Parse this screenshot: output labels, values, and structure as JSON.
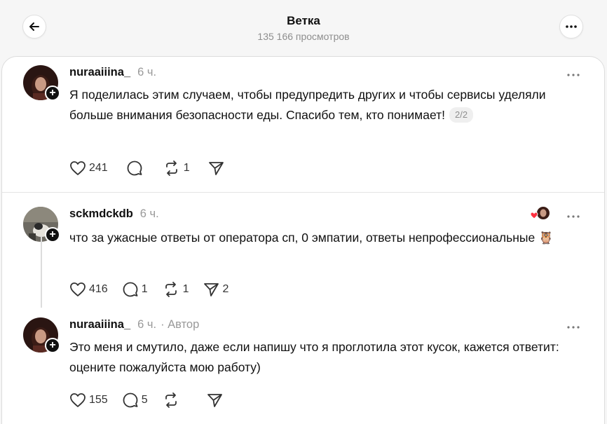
{
  "header": {
    "title": "Ветка",
    "views": "135 166 просмотров"
  },
  "posts": [
    {
      "username": "nuraaiiina_",
      "time": "6 ч.",
      "text": "Я поделилась этим случаем, чтобы предупредить других и чтобы сервисы уделяли больше внимания безопасности еды. Спасибо тем, кто понимает!",
      "pager": "2/2",
      "likes": "241",
      "replies": "",
      "reposts": "1",
      "shares": ""
    },
    {
      "username": "sckmdckdb",
      "time": "6 ч.",
      "text": "что за ужасные ответы от оператора сп, 0 эмпатии, ответы непрофессиональные",
      "emoji": "🦉",
      "likes": "416",
      "replies": "1",
      "reposts": "1",
      "shares": "2"
    },
    {
      "username": "nuraaiiina_",
      "time": "6 ч.",
      "author_tag": "· Автор",
      "text": "Это меня и смутило, даже если напишу что я проглотила этот кусок, кажется ответит: оцените пожалуйста мою работу)",
      "likes": "155",
      "replies": "5",
      "reposts": "",
      "shares": ""
    }
  ],
  "icons": {
    "back": "arrow-left-icon",
    "more": "more-horizontal-icon",
    "like": "heart-icon",
    "reply": "comment-icon",
    "repost": "repost-icon",
    "share": "send-icon",
    "follow": "plus-icon"
  },
  "colors": {
    "background": "#f6f6f6",
    "card": "#ffffff",
    "text": "#101010",
    "muted": "#999999",
    "like_heart": "#ff3040"
  }
}
